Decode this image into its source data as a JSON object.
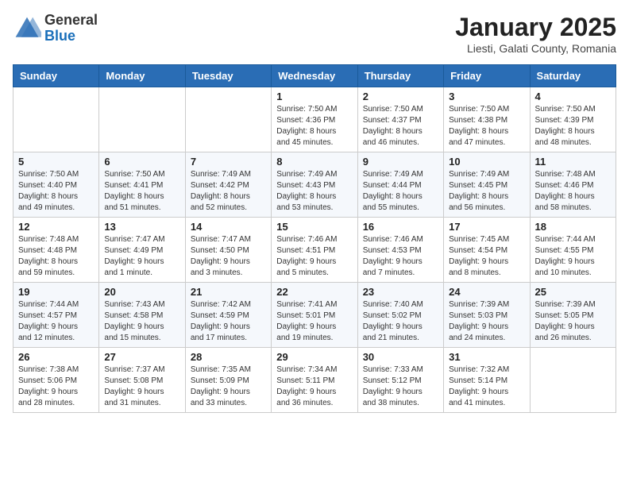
{
  "header": {
    "logo_general": "General",
    "logo_blue": "Blue",
    "month_title": "January 2025",
    "location": "Liesti, Galati County, Romania"
  },
  "days_of_week": [
    "Sunday",
    "Monday",
    "Tuesday",
    "Wednesday",
    "Thursday",
    "Friday",
    "Saturday"
  ],
  "weeks": [
    [
      {
        "day": "",
        "info": ""
      },
      {
        "day": "",
        "info": ""
      },
      {
        "day": "",
        "info": ""
      },
      {
        "day": "1",
        "info": "Sunrise: 7:50 AM\nSunset: 4:36 PM\nDaylight: 8 hours\nand 45 minutes."
      },
      {
        "day": "2",
        "info": "Sunrise: 7:50 AM\nSunset: 4:37 PM\nDaylight: 8 hours\nand 46 minutes."
      },
      {
        "day": "3",
        "info": "Sunrise: 7:50 AM\nSunset: 4:38 PM\nDaylight: 8 hours\nand 47 minutes."
      },
      {
        "day": "4",
        "info": "Sunrise: 7:50 AM\nSunset: 4:39 PM\nDaylight: 8 hours\nand 48 minutes."
      }
    ],
    [
      {
        "day": "5",
        "info": "Sunrise: 7:50 AM\nSunset: 4:40 PM\nDaylight: 8 hours\nand 49 minutes."
      },
      {
        "day": "6",
        "info": "Sunrise: 7:50 AM\nSunset: 4:41 PM\nDaylight: 8 hours\nand 51 minutes."
      },
      {
        "day": "7",
        "info": "Sunrise: 7:49 AM\nSunset: 4:42 PM\nDaylight: 8 hours\nand 52 minutes."
      },
      {
        "day": "8",
        "info": "Sunrise: 7:49 AM\nSunset: 4:43 PM\nDaylight: 8 hours\nand 53 minutes."
      },
      {
        "day": "9",
        "info": "Sunrise: 7:49 AM\nSunset: 4:44 PM\nDaylight: 8 hours\nand 55 minutes."
      },
      {
        "day": "10",
        "info": "Sunrise: 7:49 AM\nSunset: 4:45 PM\nDaylight: 8 hours\nand 56 minutes."
      },
      {
        "day": "11",
        "info": "Sunrise: 7:48 AM\nSunset: 4:46 PM\nDaylight: 8 hours\nand 58 minutes."
      }
    ],
    [
      {
        "day": "12",
        "info": "Sunrise: 7:48 AM\nSunset: 4:48 PM\nDaylight: 8 hours\nand 59 minutes."
      },
      {
        "day": "13",
        "info": "Sunrise: 7:47 AM\nSunset: 4:49 PM\nDaylight: 9 hours\nand 1 minute."
      },
      {
        "day": "14",
        "info": "Sunrise: 7:47 AM\nSunset: 4:50 PM\nDaylight: 9 hours\nand 3 minutes."
      },
      {
        "day": "15",
        "info": "Sunrise: 7:46 AM\nSunset: 4:51 PM\nDaylight: 9 hours\nand 5 minutes."
      },
      {
        "day": "16",
        "info": "Sunrise: 7:46 AM\nSunset: 4:53 PM\nDaylight: 9 hours\nand 7 minutes."
      },
      {
        "day": "17",
        "info": "Sunrise: 7:45 AM\nSunset: 4:54 PM\nDaylight: 9 hours\nand 8 minutes."
      },
      {
        "day": "18",
        "info": "Sunrise: 7:44 AM\nSunset: 4:55 PM\nDaylight: 9 hours\nand 10 minutes."
      }
    ],
    [
      {
        "day": "19",
        "info": "Sunrise: 7:44 AM\nSunset: 4:57 PM\nDaylight: 9 hours\nand 12 minutes."
      },
      {
        "day": "20",
        "info": "Sunrise: 7:43 AM\nSunset: 4:58 PM\nDaylight: 9 hours\nand 15 minutes."
      },
      {
        "day": "21",
        "info": "Sunrise: 7:42 AM\nSunset: 4:59 PM\nDaylight: 9 hours\nand 17 minutes."
      },
      {
        "day": "22",
        "info": "Sunrise: 7:41 AM\nSunset: 5:01 PM\nDaylight: 9 hours\nand 19 minutes."
      },
      {
        "day": "23",
        "info": "Sunrise: 7:40 AM\nSunset: 5:02 PM\nDaylight: 9 hours\nand 21 minutes."
      },
      {
        "day": "24",
        "info": "Sunrise: 7:39 AM\nSunset: 5:03 PM\nDaylight: 9 hours\nand 24 minutes."
      },
      {
        "day": "25",
        "info": "Sunrise: 7:39 AM\nSunset: 5:05 PM\nDaylight: 9 hours\nand 26 minutes."
      }
    ],
    [
      {
        "day": "26",
        "info": "Sunrise: 7:38 AM\nSunset: 5:06 PM\nDaylight: 9 hours\nand 28 minutes."
      },
      {
        "day": "27",
        "info": "Sunrise: 7:37 AM\nSunset: 5:08 PM\nDaylight: 9 hours\nand 31 minutes."
      },
      {
        "day": "28",
        "info": "Sunrise: 7:35 AM\nSunset: 5:09 PM\nDaylight: 9 hours\nand 33 minutes."
      },
      {
        "day": "29",
        "info": "Sunrise: 7:34 AM\nSunset: 5:11 PM\nDaylight: 9 hours\nand 36 minutes."
      },
      {
        "day": "30",
        "info": "Sunrise: 7:33 AM\nSunset: 5:12 PM\nDaylight: 9 hours\nand 38 minutes."
      },
      {
        "day": "31",
        "info": "Sunrise: 7:32 AM\nSunset: 5:14 PM\nDaylight: 9 hours\nand 41 minutes."
      },
      {
        "day": "",
        "info": ""
      }
    ]
  ]
}
